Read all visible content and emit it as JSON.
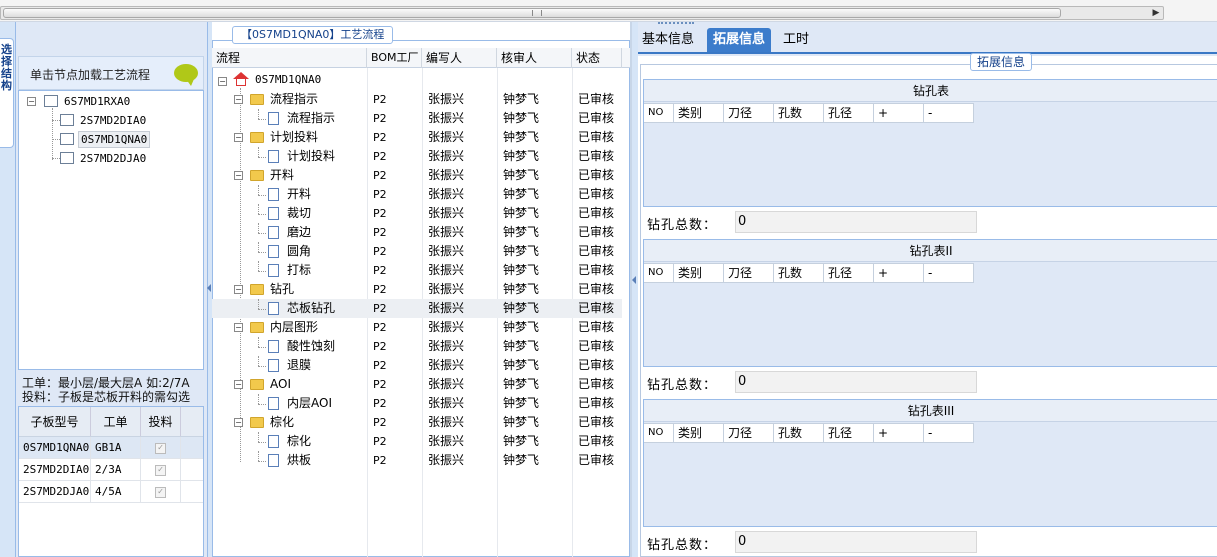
{
  "left_panel": {
    "nav_tab": "选择结构",
    "hint": "单击节点加载工艺流程",
    "tree": {
      "root": "6S7MD1RXA0",
      "children": [
        "2S7MD2DIA0",
        "0S7MD1QNA0",
        "2S7MD2DJA0"
      ]
    },
    "info_line1": "工单：最小层/最大层A 如:2/7A",
    "info_line2": "投料：子板是芯板开料的需勾选",
    "sub_table": {
      "headers": [
        "子板型号",
        "工单",
        "投料"
      ],
      "rows": [
        {
          "model": "0S7MD1QNA0",
          "order": "GB1A",
          "checked": "✓"
        },
        {
          "model": "2S7MD2DIA0",
          "order": "2/3A",
          "checked": "✓"
        },
        {
          "model": "2S7MD2DJA0",
          "order": "4/5A",
          "checked": "✓"
        }
      ]
    }
  },
  "middle_panel": {
    "title": "【0S7MD1QNA0】工艺流程",
    "headers": [
      "流程",
      "BOM工厂",
      "编写人",
      "核审人",
      "状态"
    ],
    "root": "0S7MD1QNA0",
    "rows": [
      {
        "name": "流程指示",
        "bom": "P2",
        "writer": "张振兴",
        "reviewer": "钟梦飞",
        "status": "已审核"
      },
      {
        "name": "流程指示",
        "bom": "P2",
        "writer": "张振兴",
        "reviewer": "钟梦飞",
        "status": "已审核"
      },
      {
        "name": "计划投料",
        "bom": "P2",
        "writer": "张振兴",
        "reviewer": "钟梦飞",
        "status": "已审核"
      },
      {
        "name": "计划投料",
        "bom": "P2",
        "writer": "张振兴",
        "reviewer": "钟梦飞",
        "status": "已审核"
      },
      {
        "name": "开料",
        "bom": "P2",
        "writer": "张振兴",
        "reviewer": "钟梦飞",
        "status": "已审核"
      },
      {
        "name": "开料",
        "bom": "P2",
        "writer": "张振兴",
        "reviewer": "钟梦飞",
        "status": "已审核"
      },
      {
        "name": "裁切",
        "bom": "P2",
        "writer": "张振兴",
        "reviewer": "钟梦飞",
        "status": "已审核"
      },
      {
        "name": "磨边",
        "bom": "P2",
        "writer": "张振兴",
        "reviewer": "钟梦飞",
        "status": "已审核"
      },
      {
        "name": "圆角",
        "bom": "P2",
        "writer": "张振兴",
        "reviewer": "钟梦飞",
        "status": "已审核"
      },
      {
        "name": "打标",
        "bom": "P2",
        "writer": "张振兴",
        "reviewer": "钟梦飞",
        "status": "已审核"
      },
      {
        "name": "钻孔",
        "bom": "P2",
        "writer": "张振兴",
        "reviewer": "钟梦飞",
        "status": "已审核"
      },
      {
        "name": "芯板钻孔",
        "bom": "P2",
        "writer": "张振兴",
        "reviewer": "钟梦飞",
        "status": "已审核"
      },
      {
        "name": "内层图形",
        "bom": "P2",
        "writer": "张振兴",
        "reviewer": "钟梦飞",
        "status": "已审核"
      },
      {
        "name": "酸性蚀刻",
        "bom": "P2",
        "writer": "张振兴",
        "reviewer": "钟梦飞",
        "status": "已审核"
      },
      {
        "name": "退膜",
        "bom": "P2",
        "writer": "张振兴",
        "reviewer": "钟梦飞",
        "status": "已审核"
      },
      {
        "name": "AOI",
        "bom": "P2",
        "writer": "张振兴",
        "reviewer": "钟梦飞",
        "status": "已审核"
      },
      {
        "name": "内层AOI",
        "bom": "P2",
        "writer": "张振兴",
        "reviewer": "钟梦飞",
        "status": "已审核"
      },
      {
        "name": "棕化",
        "bom": "P2",
        "writer": "张振兴",
        "reviewer": "钟梦飞",
        "status": "已审核"
      },
      {
        "name": "棕化",
        "bom": "P2",
        "writer": "张振兴",
        "reviewer": "钟梦飞",
        "status": "已审核"
      },
      {
        "name": "烘板",
        "bom": "P2",
        "writer": "张振兴",
        "reviewer": "钟梦飞",
        "status": "已审核"
      }
    ]
  },
  "right_panel": {
    "tabs": [
      "基本信息",
      "拓展信息",
      "工时"
    ],
    "active_tab": "拓展信息",
    "legend": "拓展信息",
    "sections": [
      {
        "title": "钻孔表",
        "headers": [
          "NO",
          "类别",
          "刀径",
          "孔数",
          "孔径",
          "+",
          "-"
        ],
        "total_label": "钻孔总数：",
        "total_value": "0"
      },
      {
        "title": "钻孔表II",
        "headers": [
          "NO",
          "类别",
          "刀径",
          "孔数",
          "孔径",
          "+",
          "-"
        ],
        "total_label": "钻孔总数：",
        "total_value": "0"
      },
      {
        "title": "钻孔表III",
        "headers": [
          "NO",
          "类别",
          "刀径",
          "孔数",
          "孔径",
          "+",
          "-"
        ],
        "total_label": "钻孔总数：",
        "total_value": "0"
      }
    ]
  },
  "colors": {
    "accent": "#3c7ccb",
    "panel_bg": "#dfe8f6",
    "border": "#99bbe8",
    "folder": "#f2c94c"
  }
}
